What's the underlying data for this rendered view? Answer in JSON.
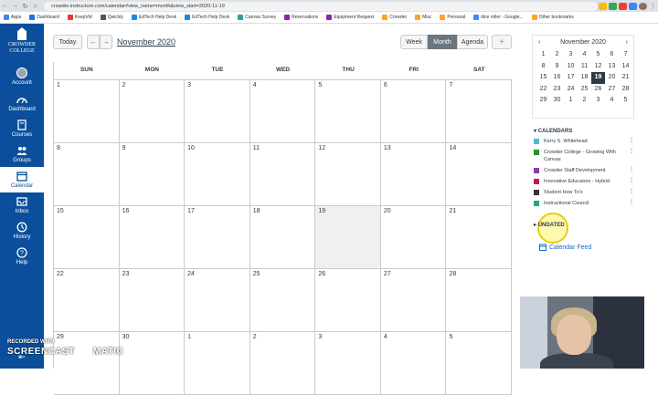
{
  "browser": {
    "url": "crowder.instructure.com/calendar#view_name=month&view_start=2020-11-19",
    "bookmarks": [
      {
        "label": "Apps",
        "color": "#4285f4"
      },
      {
        "label": "Dashboard",
        "color": "#1a73e8"
      },
      {
        "label": "KeepVid",
        "color": "#e53935"
      },
      {
        "label": "Qwickly",
        "color": "#555555"
      },
      {
        "label": "EdTech Help Desk",
        "color": "#1e88e5"
      },
      {
        "label": "EdTech Help Desk",
        "color": "#1e88e5"
      },
      {
        "label": "Canvas Survey",
        "color": "#26a69a"
      },
      {
        "label": "Reservations",
        "color": "#8e24aa"
      },
      {
        "label": "Equipment Request",
        "color": "#8e24aa"
      },
      {
        "label": "Crowder",
        "color": "#f9a825"
      },
      {
        "label": "Misc",
        "color": "#f9a825"
      },
      {
        "label": "Personal",
        "color": "#f9a825"
      },
      {
        "label": "dice roller - Google...",
        "color": "#4285f4"
      },
      {
        "label": "Other bookmarks",
        "color": "#f9a825"
      }
    ]
  },
  "global_nav": {
    "logo_line1": "CROWDER",
    "logo_line2": "COLLEGE",
    "items": [
      {
        "label": "Account"
      },
      {
        "label": "Dashboard"
      },
      {
        "label": "Courses"
      },
      {
        "label": "Groups"
      },
      {
        "label": "Calendar"
      },
      {
        "label": "Inbox"
      },
      {
        "label": "History"
      },
      {
        "label": "Help"
      }
    ]
  },
  "calendar_header": {
    "today_label": "Today",
    "prev_label": "←",
    "next_label": "→",
    "title": "November 2020",
    "views": [
      "Week",
      "Month",
      "Agenda"
    ],
    "active_view": "Month",
    "add_label": "+"
  },
  "month_grid": {
    "days_of_week": [
      "SUN",
      "MON",
      "TUE",
      "WED",
      "THU",
      "FRI",
      "SAT"
    ],
    "weeks": [
      [
        "1",
        "2",
        "3",
        "4",
        "5",
        "6",
        "7"
      ],
      [
        "8",
        "9",
        "10",
        "11",
        "12",
        "13",
        "14"
      ],
      [
        "15",
        "16",
        "17",
        "18",
        "19",
        "20",
        "21"
      ],
      [
        "22",
        "23",
        "24",
        "25",
        "26",
        "27",
        "28"
      ],
      [
        "29",
        "30",
        "1",
        "2",
        "3",
        "4",
        "5"
      ]
    ],
    "today": "19"
  },
  "mini_calendar": {
    "title": "November 2020",
    "prev": "‹",
    "next": "›",
    "weeks": [
      [
        "1",
        "2",
        "3",
        "4",
        "5",
        "6",
        "7"
      ],
      [
        "8",
        "9",
        "10",
        "11",
        "12",
        "13",
        "14"
      ],
      [
        "15",
        "16",
        "17",
        "18",
        "19",
        "20",
        "21"
      ],
      [
        "22",
        "23",
        "24",
        "25",
        "26",
        "27",
        "28"
      ],
      [
        "29",
        "30",
        "1",
        "2",
        "3",
        "4",
        "5"
      ]
    ],
    "today": "19"
  },
  "calendars": {
    "heading": "CALENDARS",
    "items": [
      {
        "name": "Kerry S. Whitehead",
        "color": "#54b8d2"
      },
      {
        "name": "Crowder College - Growing With Canvas",
        "color": "#2e8b2e"
      },
      {
        "name": "Crowder Staff Development",
        "color": "#8e3fa8"
      },
      {
        "name": "Innovative Educators - Hybrid",
        "color": "#c2185b"
      },
      {
        "name": "Student How To's",
        "color": "#333333"
      },
      {
        "name": "Instructional Council",
        "color": "#2aa876"
      }
    ],
    "more_icon": "⋮"
  },
  "undated": {
    "label": "UNDATED"
  },
  "feed": {
    "label": "Calendar Feed"
  },
  "watermark": {
    "line1": "RECORDED WITH",
    "brand_left": "SCREENCAST",
    "brand_right": "MATIC"
  }
}
